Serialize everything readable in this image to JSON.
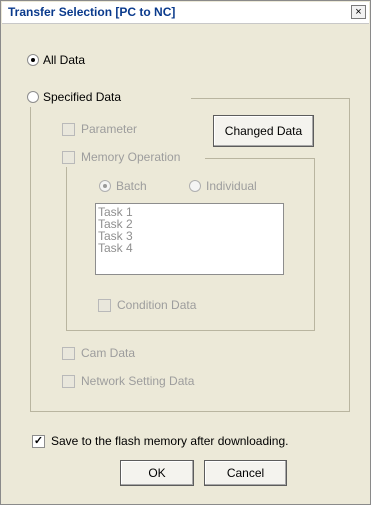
{
  "window": {
    "title": "Transfer Selection [PC to NC]",
    "close_glyph": "×"
  },
  "options": {
    "all_data": {
      "label": "All Data",
      "checked": true
    },
    "specified_data": {
      "label": "Specified Data",
      "checked": false
    }
  },
  "specified": {
    "parameter_label": "Parameter",
    "changed_data_button": "Changed Data",
    "memory_operation": {
      "label": "Memory Operation",
      "batch_label": "Batch",
      "individual_label": "Individual",
      "tasks": [
        "Task 1",
        "Task 2",
        "Task 3",
        "Task 4"
      ],
      "condition_data_label": "Condition Data"
    },
    "cam_data_label": "Cam Data",
    "network_setting_label": "Network Setting Data"
  },
  "save_flash": {
    "label": "Save to the flash memory after downloading.",
    "checked": true,
    "check_glyph": "✓"
  },
  "buttons": {
    "ok": "OK",
    "cancel": "Cancel"
  },
  "colors": {
    "title_text": "#0a3a8c",
    "dialog_bg": "#ece9d8",
    "disabled_text": "#9d9d9d"
  }
}
